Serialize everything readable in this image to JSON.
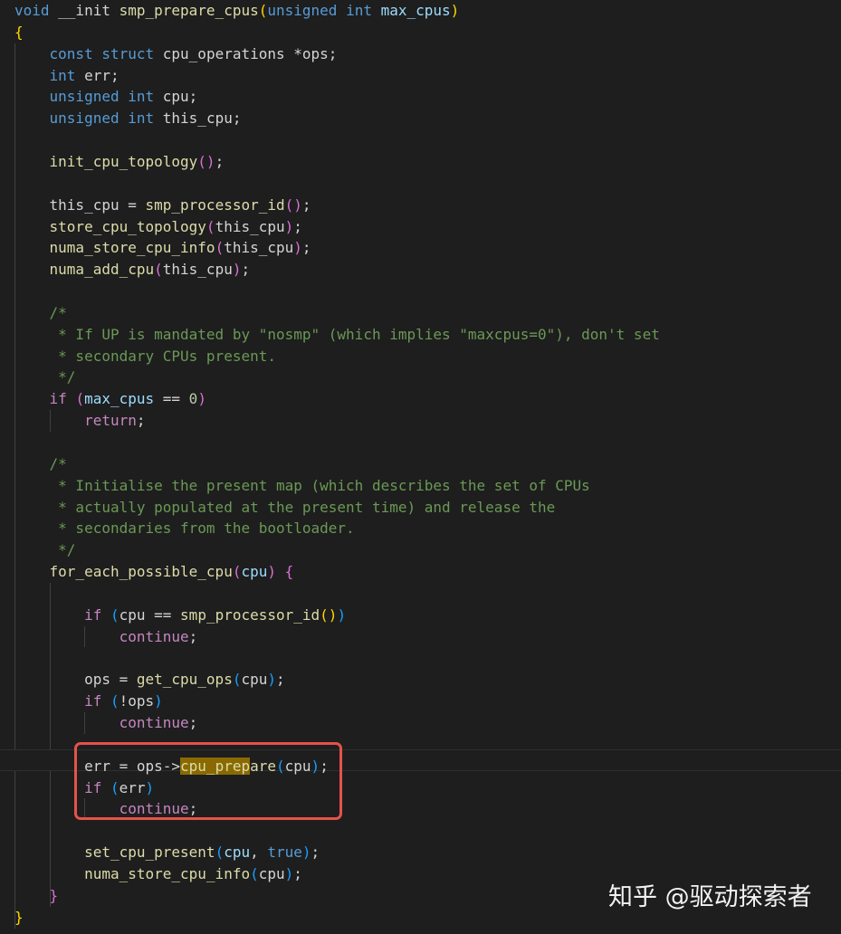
{
  "editor": {
    "lines": [
      [
        [
          "kw",
          "void"
        ],
        [
          "txt",
          " __init "
        ],
        [
          "fn",
          "smp_prepare_cpus"
        ],
        [
          "b1",
          "("
        ],
        [
          "kw",
          "unsigned"
        ],
        [
          "txt",
          " "
        ],
        [
          "kw",
          "int"
        ],
        [
          "txt",
          " "
        ],
        [
          "var",
          "max_cpus"
        ],
        [
          "b1",
          ")"
        ]
      ],
      [
        [
          "b1",
          "{"
        ]
      ],
      [
        [
          "txt",
          "    "
        ],
        [
          "kw",
          "const"
        ],
        [
          "txt",
          " "
        ],
        [
          "kw",
          "struct"
        ],
        [
          "txt",
          " cpu_operations *ops;"
        ]
      ],
      [
        [
          "txt",
          "    "
        ],
        [
          "kw",
          "int"
        ],
        [
          "txt",
          " err;"
        ]
      ],
      [
        [
          "txt",
          "    "
        ],
        [
          "kw",
          "unsigned"
        ],
        [
          "txt",
          " "
        ],
        [
          "kw",
          "int"
        ],
        [
          "txt",
          " cpu;"
        ]
      ],
      [
        [
          "txt",
          "    "
        ],
        [
          "kw",
          "unsigned"
        ],
        [
          "txt",
          " "
        ],
        [
          "kw",
          "int"
        ],
        [
          "txt",
          " this_cpu;"
        ]
      ],
      [],
      [
        [
          "txt",
          "    "
        ],
        [
          "fn",
          "init_cpu_topology"
        ],
        [
          "b2",
          "()"
        ],
        [
          "txt",
          ";"
        ]
      ],
      [],
      [
        [
          "txt",
          "    this_cpu = "
        ],
        [
          "fn",
          "smp_processor_id"
        ],
        [
          "b2",
          "()"
        ],
        [
          "txt",
          ";"
        ]
      ],
      [
        [
          "txt",
          "    "
        ],
        [
          "fn",
          "store_cpu_topology"
        ],
        [
          "b2",
          "("
        ],
        [
          "txt",
          "this_cpu"
        ],
        [
          "b2",
          ")"
        ],
        [
          "txt",
          ";"
        ]
      ],
      [
        [
          "txt",
          "    "
        ],
        [
          "fn",
          "numa_store_cpu_info"
        ],
        [
          "b2",
          "("
        ],
        [
          "txt",
          "this_cpu"
        ],
        [
          "b2",
          ")"
        ],
        [
          "txt",
          ";"
        ]
      ],
      [
        [
          "txt",
          "    "
        ],
        [
          "fn",
          "numa_add_cpu"
        ],
        [
          "b2",
          "("
        ],
        [
          "txt",
          "this_cpu"
        ],
        [
          "b2",
          ")"
        ],
        [
          "txt",
          ";"
        ]
      ],
      [],
      [
        [
          "txt",
          "    "
        ],
        [
          "cmt",
          "/*"
        ]
      ],
      [
        [
          "txt",
          "    "
        ],
        [
          "cmt",
          " * If UP is mandated by \"nosmp\" (which implies \"maxcpus=0\"), don't set"
        ]
      ],
      [
        [
          "txt",
          "    "
        ],
        [
          "cmt",
          " * secondary CPUs present."
        ]
      ],
      [
        [
          "txt",
          "    "
        ],
        [
          "cmt",
          " */"
        ]
      ],
      [
        [
          "txt",
          "    "
        ],
        [
          "ctl",
          "if"
        ],
        [
          "txt",
          " "
        ],
        [
          "b2",
          "("
        ],
        [
          "var",
          "max_cpus"
        ],
        [
          "txt",
          " == "
        ],
        [
          "num",
          "0"
        ],
        [
          "b2",
          ")"
        ]
      ],
      [
        [
          "txt",
          "        "
        ],
        [
          "ctl",
          "return"
        ],
        [
          "txt",
          ";"
        ]
      ],
      [],
      [
        [
          "txt",
          "    "
        ],
        [
          "cmt",
          "/*"
        ]
      ],
      [
        [
          "txt",
          "    "
        ],
        [
          "cmt",
          " * Initialise the present map (which describes the set of CPUs"
        ]
      ],
      [
        [
          "txt",
          "    "
        ],
        [
          "cmt",
          " * actually populated at the present time) and release the"
        ]
      ],
      [
        [
          "txt",
          "    "
        ],
        [
          "cmt",
          " * secondaries from the bootloader."
        ]
      ],
      [
        [
          "txt",
          "    "
        ],
        [
          "cmt",
          " */"
        ]
      ],
      [
        [
          "txt",
          "    "
        ],
        [
          "fn",
          "for_each_possible_cpu"
        ],
        [
          "b2",
          "("
        ],
        [
          "var",
          "cpu"
        ],
        [
          "b2",
          ")"
        ],
        [
          "txt",
          " "
        ],
        [
          "b2",
          "{"
        ]
      ],
      [],
      [
        [
          "txt",
          "        "
        ],
        [
          "ctl",
          "if"
        ],
        [
          "txt",
          " "
        ],
        [
          "b3",
          "("
        ],
        [
          "txt",
          "cpu == "
        ],
        [
          "fn",
          "smp_processor_id"
        ],
        [
          "b1",
          "()"
        ],
        [
          "b3",
          ")"
        ]
      ],
      [
        [
          "txt",
          "            "
        ],
        [
          "ctl",
          "continue"
        ],
        [
          "txt",
          ";"
        ]
      ],
      [],
      [
        [
          "txt",
          "        ops = "
        ],
        [
          "fn",
          "get_cpu_ops"
        ],
        [
          "b3",
          "("
        ],
        [
          "txt",
          "cpu"
        ],
        [
          "b3",
          ")"
        ],
        [
          "txt",
          ";"
        ]
      ],
      [
        [
          "txt",
          "        "
        ],
        [
          "ctl",
          "if"
        ],
        [
          "txt",
          " "
        ],
        [
          "b3",
          "("
        ],
        [
          "txt",
          "!ops"
        ],
        [
          "b3",
          ")"
        ]
      ],
      [
        [
          "txt",
          "            "
        ],
        [
          "ctl",
          "continue"
        ],
        [
          "txt",
          ";"
        ]
      ],
      [],
      [
        [
          "txt",
          "        err = ops->"
        ],
        [
          "hl",
          "cpu_prep"
        ],
        [
          "fn",
          "are"
        ],
        [
          "b3",
          "("
        ],
        [
          "txt",
          "cpu"
        ],
        [
          "b3",
          ")"
        ],
        [
          "txt",
          ";"
        ]
      ],
      [
        [
          "txt",
          "        "
        ],
        [
          "ctl",
          "if"
        ],
        [
          "txt",
          " "
        ],
        [
          "b3",
          "("
        ],
        [
          "txt",
          "err"
        ],
        [
          "b3",
          ")"
        ]
      ],
      [
        [
          "txt",
          "            "
        ],
        [
          "ctl",
          "continue"
        ],
        [
          "txt",
          ";"
        ]
      ],
      [],
      [
        [
          "txt",
          "        "
        ],
        [
          "fn",
          "set_cpu_present"
        ],
        [
          "b3",
          "("
        ],
        [
          "var",
          "cpu"
        ],
        [
          "txt",
          ", "
        ],
        [
          "kw",
          "true"
        ],
        [
          "b3",
          ")"
        ],
        [
          "txt",
          ";"
        ]
      ],
      [
        [
          "txt",
          "        "
        ],
        [
          "fn",
          "numa_store_cpu_info"
        ],
        [
          "b3",
          "("
        ],
        [
          "txt",
          "cpu"
        ],
        [
          "b3",
          ")"
        ],
        [
          "txt",
          ";"
        ]
      ],
      [
        [
          "txt",
          "    "
        ],
        [
          "b2",
          "}"
        ]
      ],
      [
        [
          "b1",
          "}"
        ]
      ]
    ]
  },
  "colors": {
    "background": "#1e1e1e",
    "keyword": "#569cd6",
    "control": "#c586c0",
    "function": "#dcdcaa",
    "variable": "#9cdcfe",
    "comment": "#6a9955",
    "highlight_box": "#e5534b",
    "search_match": "#8a6a00"
  },
  "watermark": {
    "text": "知乎 @驱动探索者"
  }
}
